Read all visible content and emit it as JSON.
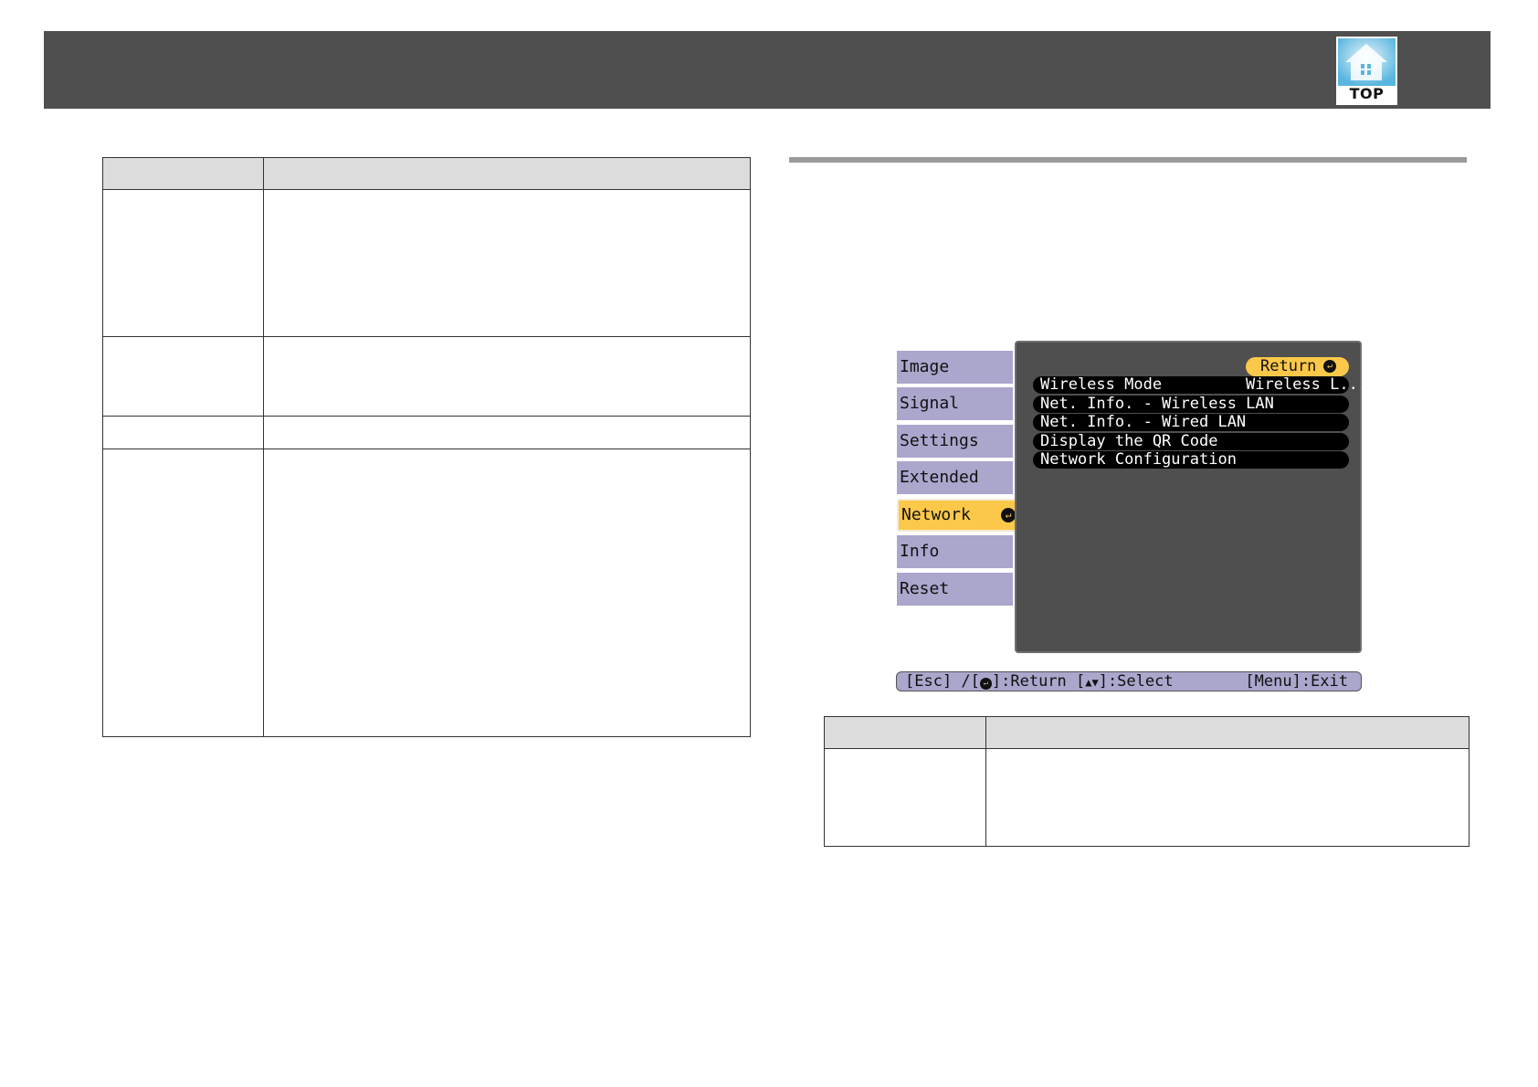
{
  "header": {
    "top_button_label": "TOP",
    "top_button_icon": "home-icon"
  },
  "osd": {
    "tabs": [
      {
        "label": "Image"
      },
      {
        "label": "Signal"
      },
      {
        "label": "Settings"
      },
      {
        "label": "Extended"
      },
      {
        "label": "Network",
        "active": true
      },
      {
        "label": "Info"
      },
      {
        "label": "Reset"
      }
    ],
    "return_label": "Return",
    "items": [
      {
        "label": "Wireless Mode",
        "value": "Wireless L..."
      },
      {
        "label": "Net. Info. - Wireless LAN",
        "value": ""
      },
      {
        "label": "Net. Info. - Wired LAN",
        "value": ""
      },
      {
        "label": "Display the QR Code",
        "value": ""
      },
      {
        "label": "Network Configuration",
        "value": ""
      }
    ],
    "footer_left_esc": "[Esc] /[",
    "footer_left_return": "]:Return  [",
    "footer_left_select": "]:Select",
    "footer_right": "[Menu]:Exit"
  },
  "colors": {
    "header_bg": "#4f4f4f",
    "tab_bg": "#aaa6cc",
    "active_tab_bg": "#fcc84a",
    "panel_bg": "#4f4f4f",
    "item_bg": "#000000",
    "table_header_bg": "#dcdcdc"
  }
}
